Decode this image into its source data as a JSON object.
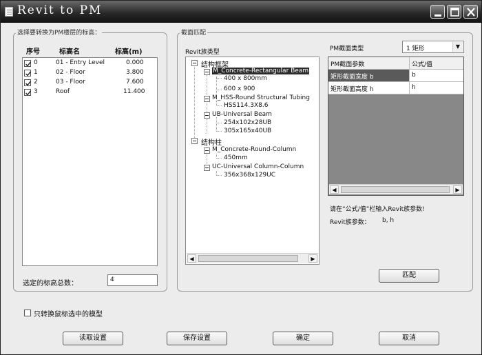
{
  "window": {
    "title": "Revit to PM"
  },
  "levels_group": {
    "title": "选择要转换为PM楼层的标高：",
    "headers": [
      "序号",
      "标高名",
      "标高(m)"
    ],
    "rows": [
      {
        "index": "0",
        "name": "01 - Entry Level",
        "elevation": "0.000",
        "checked": true
      },
      {
        "index": "1",
        "name": "02 - Floor",
        "elevation": "3.800",
        "checked": true
      },
      {
        "index": "2",
        "name": "03 - Floor",
        "elevation": "7.600",
        "checked": true
      },
      {
        "index": "3",
        "name": "Roof",
        "elevation": "11.400",
        "checked": true
      }
    ],
    "count_label": "选定的标高总数：",
    "count_value": "4"
  },
  "section_group": {
    "title": "截面匹配",
    "family_type_label": "Revit族类型",
    "tree": {
      "beam_category": "结构框架",
      "beam_families": [
        {
          "name": "M_Concrete-Rectangular Beam",
          "types": [
            "400 x 800mm",
            "600 x 900"
          ]
        },
        {
          "name": "M_HSS-Round Structural Tubing",
          "types": [
            "HSS114.3X8.6"
          ]
        },
        {
          "name": "UB-Universal Beam",
          "types": [
            "254x102x28UB",
            "305x165x40UB"
          ]
        }
      ],
      "column_category": "结构柱",
      "column_families": [
        {
          "name": "M_Concrete-Round-Column",
          "types": [
            "450mm"
          ]
        },
        {
          "name": "UC-Universal Column-Column",
          "types": [
            "356x368x129UC"
          ]
        }
      ]
    },
    "pm_type_label": "PM截面类型",
    "pm_type_value": "1 矩形",
    "param_grid": {
      "headers": [
        "PM截面参数",
        "公式/值"
      ],
      "rows": [
        {
          "param": "矩形截面宽度 b",
          "value": "b"
        },
        {
          "param": "矩形截面高度 h",
          "value": "h"
        }
      ]
    },
    "hint_text": "请在“公式/值”栏输入Revit族参数!",
    "revit_params_label": "Revit族参数：",
    "revit_params_value": "b, h",
    "match_button": "匹配"
  },
  "only_selected_checkbox": {
    "label": "只转换鼠标选中的模型",
    "checked": false
  },
  "buttons": {
    "read_settings": "读取设置",
    "save_settings": "保存设置",
    "ok": "确定",
    "cancel": "取消"
  }
}
